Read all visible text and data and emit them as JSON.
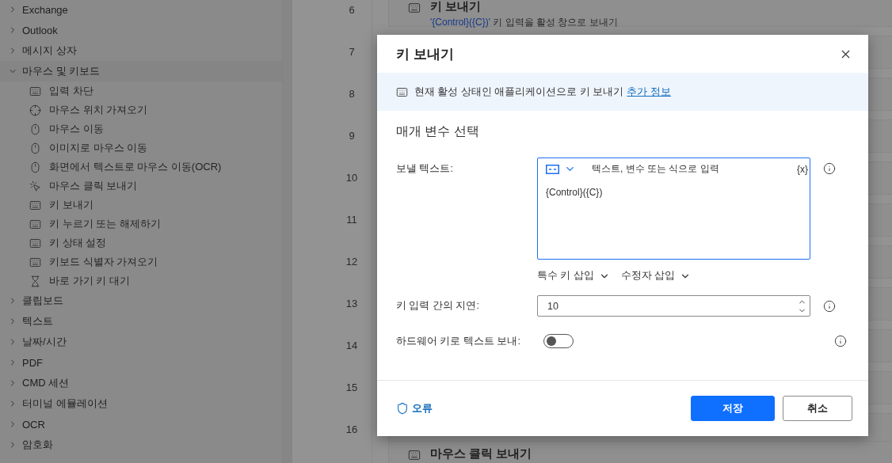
{
  "sidebar": {
    "items": [
      {
        "label": "Exchange",
        "expanded": false
      },
      {
        "label": "Outlook",
        "expanded": false
      },
      {
        "label": "메시지 상자",
        "expanded": false
      },
      {
        "label": "마우스 및 키보드",
        "expanded": true,
        "children": [
          {
            "label": "입력 차단",
            "kind": "keyboard"
          },
          {
            "label": "마우스 위치 가져오기",
            "kind": "target"
          },
          {
            "label": "마우스 이동",
            "kind": "mouse"
          },
          {
            "label": "이미지로 마우스 이동",
            "kind": "mouse"
          },
          {
            "label": "화면에서 텍스트로 마우스 이동(OCR)",
            "kind": "mouse"
          },
          {
            "label": "마우스 클릭 보내기",
            "kind": "click"
          },
          {
            "label": "키 보내기",
            "kind": "keyboard"
          },
          {
            "label": "키 누르기 또는 해제하기",
            "kind": "keyboard"
          },
          {
            "label": "키 상태 설정",
            "kind": "keyboard"
          },
          {
            "label": "키보드 식별자 가져오기",
            "kind": "keyboard"
          },
          {
            "label": "바로 가기 키 대기",
            "kind": "wait"
          }
        ]
      },
      {
        "label": "클립보드",
        "expanded": false
      },
      {
        "label": "텍스트",
        "expanded": false
      },
      {
        "label": "날짜/시간",
        "expanded": false
      },
      {
        "label": "PDF",
        "expanded": false
      },
      {
        "label": "CMD 세션",
        "expanded": false
      },
      {
        "label": "터미널 에뮬레이션",
        "expanded": false
      },
      {
        "label": "OCR",
        "expanded": false
      },
      {
        "label": "암호화",
        "expanded": false
      }
    ]
  },
  "steps": [
    {
      "number": "6",
      "title": "키 보내기",
      "param": "'{Control}({C})'",
      "description": "키 입력을 활성 창으로 보내기"
    },
    {
      "number": "7"
    },
    {
      "number": "8"
    },
    {
      "number": "9"
    },
    {
      "number": "10"
    },
    {
      "number": "11"
    },
    {
      "number": "12"
    },
    {
      "number": "13"
    },
    {
      "number": "14"
    },
    {
      "number": "15"
    },
    {
      "number": "16"
    },
    {
      "title": "마우스 클릭 보내기"
    }
  ],
  "dialog": {
    "title": "키 보내기",
    "banner": {
      "text": "현재 활성 상태인 애플리케이션으로 키 보내기",
      "link": "추가 정보"
    },
    "section": "매개 변수 선택",
    "text_field": {
      "label": "보낼 텍스트:",
      "hint": "텍스트, 변수 또는 식으로 입력",
      "variable_button": "{x}",
      "value": "{Control}({C})"
    },
    "insert_menus": [
      "특수 키 삽입",
      "수정자 삽입"
    ],
    "delay_field": {
      "label": "키 입력 간의 지연:",
      "value": "10"
    },
    "hardware_toggle": {
      "label": "하드웨어 키로 텍스트 보내:",
      "on": false
    },
    "error_link": "오류",
    "buttons": [
      {
        "label": "저장",
        "kind": "primary"
      },
      {
        "label": "취소",
        "kind": "secondary"
      }
    ]
  }
}
